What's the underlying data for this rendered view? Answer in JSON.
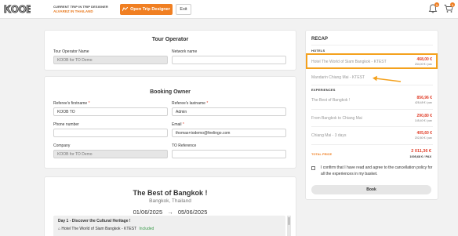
{
  "header": {
    "logo_text": "KOOB",
    "trip_label": "CURRENT TRIP IN TRIP DESIGNER",
    "trip_name": "ALVAREZ IN THAILAND",
    "open_designer_label": "Open Trip Designer",
    "exit_label": "Exit",
    "notification_count": "1",
    "cart_count": "1"
  },
  "tour_operator": {
    "title": "Tour Operator",
    "name_label": "Tour Operator Name",
    "name_value": "KOOB for TO Demo",
    "network_label": "Network name",
    "network_value": ""
  },
  "booking_owner": {
    "title": "Booking Owner",
    "firstname_label": "Referee's firstname",
    "firstname_value": "KOOB TO",
    "lastname_label": "Referee's lastname",
    "lastname_value": "Admin",
    "phone_label": "Phone number",
    "phone_value": "",
    "email_label": "Email",
    "email_value": "thomas+todemo@feelingo.com",
    "company_label": "Company",
    "company_value": "KOOB for TO Demo",
    "reference_label": "TO Reference",
    "reference_value": ""
  },
  "tour": {
    "title": "The Best of Bangkok !",
    "location": "Bangkok, Thailand",
    "date_from": "01/06/2025",
    "arrow": "→",
    "date_to": "05/06/2025",
    "day_title": "Day 1 - Discover the Cultural Heritage !",
    "day_hotel": "Hotel The World of Siam Bangkok - KTEST",
    "day_included": "Included"
  },
  "recap": {
    "title": "RECAP",
    "hotels_label": "HOTELS",
    "hotels": [
      {
        "name": "Hotel The World of Siam Bangkok - KTEST",
        "price": "468,00 €",
        "sub": "234,00 € / pax"
      },
      {
        "name": "Mandarin Chiang Mai - KTEST",
        "price": "",
        "sub": ""
      }
    ],
    "experiences_label": "EXPERIENCES",
    "experiences": [
      {
        "name": "The Best of Bangkok !",
        "price": "856,96 €",
        "sub": "428,48 € / pax"
      },
      {
        "name": "From Bangkok to Chiang Mai",
        "price": "290,80 €",
        "sub": "145,40 € / pax"
      },
      {
        "name": "Chiang Mai - 3 days",
        "price": "405,60 €",
        "sub": "202,80 € / pax"
      }
    ],
    "total_label": "TOTAL PRICE",
    "total_price": "2 011,36 €",
    "total_sub": "1005,68 € / PAX",
    "confirm_text": "I confirm that I have read and agree to the cancellation policy for all the experiences in my basket.",
    "book_label": "Book"
  },
  "colors": {
    "accent": "#f07f22",
    "price": "#e1412c",
    "highlight": "#f4a11d"
  }
}
